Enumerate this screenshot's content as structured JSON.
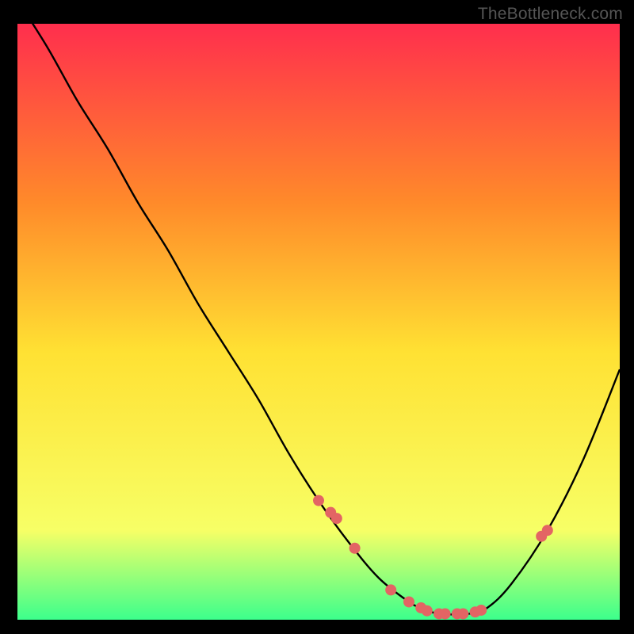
{
  "watermark": "TheBottleneck.com",
  "chart_data": {
    "type": "line",
    "title": "",
    "xlabel": "",
    "ylabel": "",
    "xlim": [
      0,
      100
    ],
    "ylim": [
      0,
      100
    ],
    "grid": false,
    "legend": false,
    "background_gradient": {
      "top": "#ff2e4d",
      "upper_mid": "#ff8a2a",
      "mid": "#ffe133",
      "lower": "#f7ff66",
      "bottom": "#3cff8c"
    },
    "series": [
      {
        "name": "bottleneck-curve",
        "x": [
          0,
          5,
          10,
          15,
          20,
          25,
          30,
          35,
          40,
          45,
          50,
          55,
          60,
          65,
          67,
          70,
          75,
          78,
          82,
          88,
          94,
          100
        ],
        "y": [
          104,
          96,
          87,
          79,
          70,
          62,
          53,
          45,
          37,
          28,
          20,
          13,
          7,
          3,
          2,
          1,
          1,
          2,
          6,
          15,
          27,
          42
        ]
      }
    ],
    "markers": {
      "name": "highlight-points",
      "color": "#e36464",
      "x": [
        50,
        52,
        53,
        56,
        62,
        65,
        67,
        68,
        70,
        71,
        73,
        74,
        76,
        77,
        87,
        88
      ],
      "y": [
        20,
        18,
        17,
        12,
        5,
        3,
        2,
        1.5,
        1,
        1,
        1,
        1,
        1.3,
        1.6,
        14,
        15
      ]
    }
  }
}
